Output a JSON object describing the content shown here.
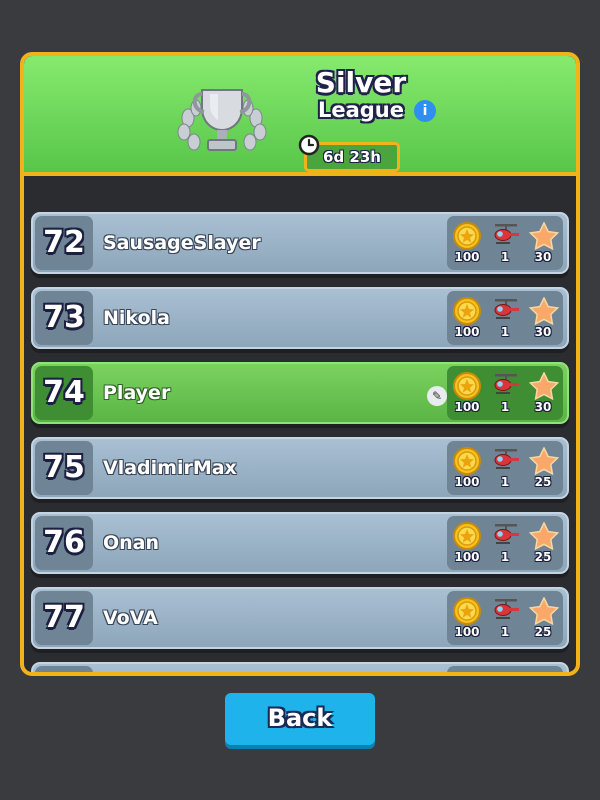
{
  "league": {
    "name": "Silver",
    "subtitle": "League",
    "info_icon": "i",
    "timer": "6d 23h"
  },
  "rows": [
    {
      "rank": "",
      "name": "",
      "coins": "100",
      "heli": "1",
      "stars": "30",
      "me": false
    },
    {
      "rank": "72",
      "name": "SausageSlayer",
      "coins": "100",
      "heli": "1",
      "stars": "30",
      "me": false
    },
    {
      "rank": "73",
      "name": "Nikola",
      "coins": "100",
      "heli": "1",
      "stars": "30",
      "me": false
    },
    {
      "rank": "74",
      "name": "Player",
      "coins": "100",
      "heli": "1",
      "stars": "30",
      "me": true
    },
    {
      "rank": "75",
      "name": "VladimirMax",
      "coins": "100",
      "heli": "1",
      "stars": "25",
      "me": false
    },
    {
      "rank": "76",
      "name": "Onan",
      "coins": "100",
      "heli": "1",
      "stars": "25",
      "me": false
    },
    {
      "rank": "77",
      "name": "VoVA",
      "coins": "100",
      "heli": "1",
      "stars": "25",
      "me": false
    },
    {
      "rank": "",
      "name": "",
      "coins": "",
      "heli": "",
      "stars": "",
      "me": false
    }
  ],
  "back_label": "Back",
  "icons": {
    "trophy": "trophy-icon",
    "clock": "clock-icon",
    "coin": "coin-icon",
    "helicopter": "helicopter-icon",
    "star": "star-icon",
    "edit": "pencil-icon"
  },
  "colors": {
    "header_green": "#6ad95a",
    "frame_gold": "#f2b21a",
    "row_blue": "#a3bbce",
    "row_player": "#6cc653",
    "back_button": "#1eb3ea"
  }
}
